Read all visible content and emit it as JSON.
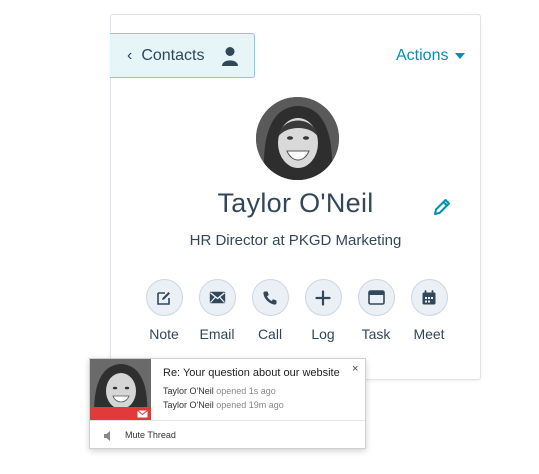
{
  "nav": {
    "back_label": "Contacts"
  },
  "header": {
    "actions_label": "Actions"
  },
  "contact": {
    "name": "Taylor O'Neil",
    "title": "HR Director at PKGD Marketing"
  },
  "activities": [
    {
      "label": "Note",
      "icon": "note-icon"
    },
    {
      "label": "Email",
      "icon": "email-icon"
    },
    {
      "label": "Call",
      "icon": "phone-icon"
    },
    {
      "label": "Log",
      "icon": "plus-icon"
    },
    {
      "label": "Task",
      "icon": "task-icon"
    },
    {
      "label": "Meet",
      "icon": "calendar-icon"
    }
  ],
  "notification": {
    "subject": "Re: Your question about our website",
    "events": [
      {
        "who": "Taylor O'Neil",
        "what": "opened 1s ago"
      },
      {
        "who": "Taylor O'Neil",
        "what": "opened 19m ago"
      }
    ],
    "close": "×",
    "mute_label": "Mute Thread"
  },
  "colors": {
    "accent": "#0091ae",
    "tab_bg": "#e5f5f8",
    "text": "#33475b",
    "button_bg": "#eaf0f6",
    "alert_red": "#e03a3a"
  }
}
